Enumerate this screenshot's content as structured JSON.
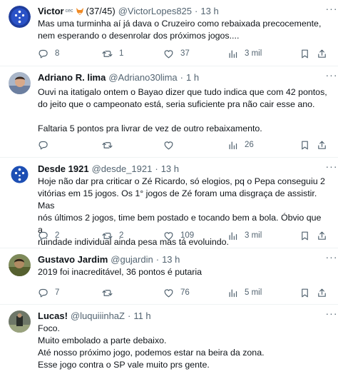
{
  "tweets": [
    {
      "name": "Victor",
      "badge": "cec",
      "extra": "(37/45)",
      "handle": "@VictorLopes825",
      "time": "13 h",
      "lines": [
        "Mas uma turminha aí já dava o Cruzeiro como rebaixada precocemente,",
        "nem esperando o desenrolar dos próximos jogos...."
      ],
      "replies": "8",
      "retweets": "1",
      "likes": "37",
      "views": "3 mil"
    },
    {
      "name": "Adriano R. lima",
      "handle": "@Adriano30lima",
      "time": "1 h",
      "lines": [
        "Ouvi na itatigalo ontem o Bayao dizer que tudo indica que com 42 pontos,",
        "do jeito que o campeonato está, seria suficiente pra não cair esse ano.",
        "",
        "Faltaria 5 pontos pra livrar de vez de outro rebaixamento."
      ],
      "replies": "",
      "retweets": "",
      "likes": "",
      "views": "26"
    },
    {
      "name": "Desde 1921",
      "handle": "@desde_1921",
      "time": "13 h",
      "lines": [
        "Hoje não dar pra criticar o Zé Ricardo, só elogios, pq o Pepa conseguiu 2",
        "vitórias em 15 jogos. Os 1° jogos de Zé foram uma disgraça de assistir. Mas",
        "nós últimos 2 jogos, time bem postado e tocando bem a bola. Óbvio que a",
        "ruindade individual ainda pesa mas tá evoluindo."
      ],
      "replies": "2",
      "retweets": "2",
      "likes": "109",
      "views": "3 mil"
    },
    {
      "name": "Gustavo Jardim",
      "handle": "@gujardin",
      "time": "13 h",
      "lines": [
        "2019 foi inacreditável, 36 pontos é putaria"
      ],
      "replies": "7",
      "retweets": "",
      "likes": "76",
      "views": "5 mil"
    },
    {
      "name": "Lucas!",
      "handle": "@luquiiinhaZ",
      "time": "11 h",
      "lines": [
        "Foco.",
        "Muito embolado a parte debaixo.",
        "Até nosso próximo jogo, podemos estar na beira da zona.",
        "Esse jogo contra o SP vale muito prs gente."
      ]
    }
  ],
  "colors": {
    "text": "#0f1419",
    "secondary": "#536471",
    "divider": "#eff3f4"
  },
  "icons": [
    "reply-icon",
    "retweet-icon",
    "like-icon",
    "views-icon",
    "bookmark-icon",
    "share-icon",
    "more-icon"
  ]
}
